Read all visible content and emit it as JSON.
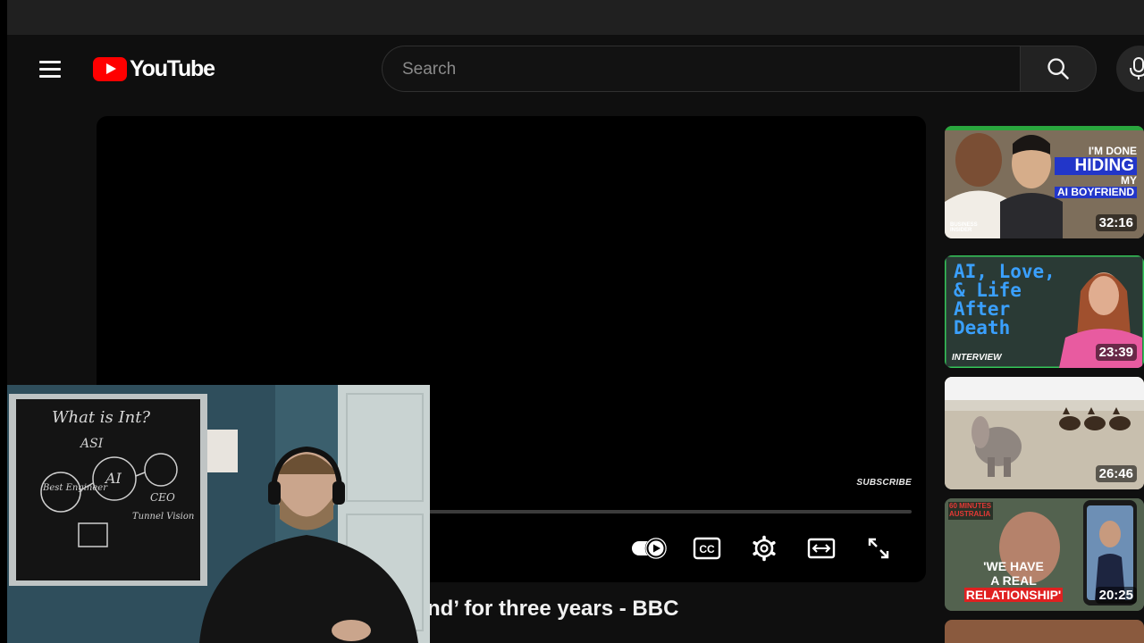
{
  "search": {
    "placeholder": "Search"
  },
  "logo": {
    "text": "YouTube"
  },
  "player": {
    "watermark": "SUBSCRIBE",
    "title": "nd’ for three years - BBC"
  },
  "webcam": {
    "board_title": "What is Int?",
    "board_labels": [
      "ASI",
      "Best Engineer",
      "AI",
      "CEO",
      "Tunnel Vision"
    ]
  },
  "recommendations": [
    {
      "duration": "32:16",
      "overlay_lines": [
        "I'M DONE",
        "HIDING",
        "MY",
        "AI BOYFRIEND"
      ],
      "channel_tag": "BUSINESS INSIDER"
    },
    {
      "duration": "23:39",
      "overlay_lines": [
        "AI, Love,",
        "& Life",
        "After",
        "Death"
      ],
      "channel_tag": "INTERVIEW"
    },
    {
      "duration": "26:46"
    },
    {
      "duration": "20:25",
      "overlay_lines": [
        "'WE HAVE",
        "A REAL",
        "RELATIONSHIP'"
      ],
      "channel_tag": "60 MINUTES AUSTRALIA"
    }
  ],
  "colors": {
    "brand_red": "#ff0000",
    "background": "#0f0f0f"
  },
  "icons": [
    "menu-icon",
    "youtube-logo-icon",
    "search-icon",
    "mic-icon",
    "autoplay-toggle-icon",
    "captions-icon",
    "settings-icon",
    "theater-mode-icon",
    "fullscreen-icon"
  ]
}
